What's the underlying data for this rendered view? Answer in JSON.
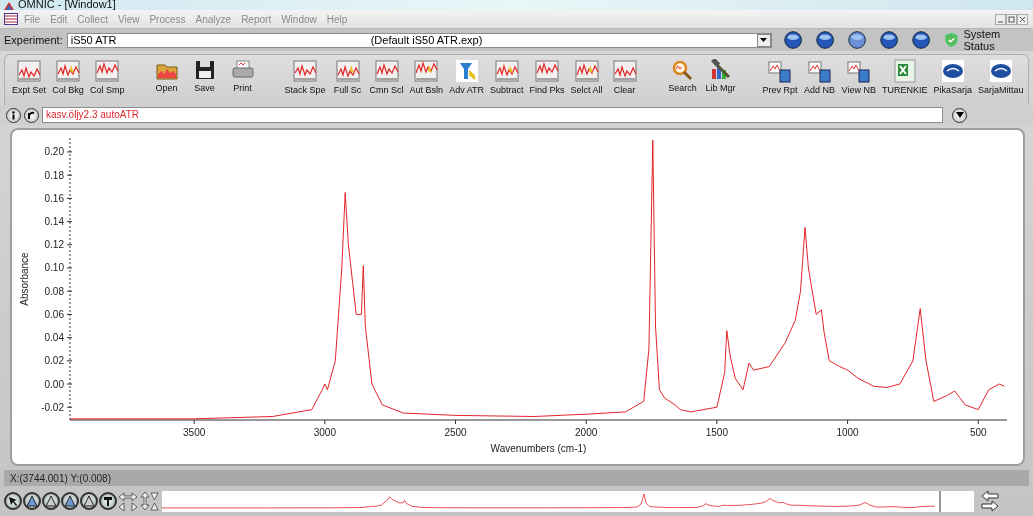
{
  "window": {
    "title": "OMNIC - [Window1]"
  },
  "menu": [
    "File",
    "Edit",
    "Collect",
    "View",
    "Process",
    "Analyze",
    "Report",
    "Window",
    "Help"
  ],
  "experiment": {
    "label": "Experiment:",
    "value": "iS50 ATR",
    "file": "(Default iS50 ATR.exp)",
    "status": "System Status"
  },
  "toolbar": {
    "groups": [
      [
        "Expt Set",
        "Col Bkg",
        "Col Smp"
      ],
      [
        "Open",
        "Save",
        "Print"
      ],
      [
        "Stack Spe",
        "Full Sc",
        "Cmn Scl",
        "Aut Bsln",
        "Adv ATR",
        "Subtract",
        "Find Pks",
        "Selct All",
        "Clear"
      ],
      [
        "Search",
        "Lib Mgr"
      ],
      [
        "Prev Rpt",
        "Add NB",
        "View NB",
        "TURENKIE",
        "PikaSarja",
        "SarjaMittau"
      ]
    ]
  },
  "spectrum_title": "kasv.öljy2.3 autoATR",
  "chart_data": {
    "type": "line",
    "xlabel": "Wavenumbers (cm-1)",
    "ylabel": "Absorbance",
    "x": [
      3975,
      3500,
      3200,
      3050,
      3010,
      3000,
      2990,
      2960,
      2935,
      2922,
      2910,
      2880,
      2860,
      2853,
      2845,
      2820,
      2780,
      2700,
      2500,
      2200,
      2000,
      1850,
      1780,
      1760,
      1745,
      1735,
      1720,
      1700,
      1660,
      1640,
      1600,
      1500,
      1470,
      1462,
      1450,
      1430,
      1400,
      1377,
      1360,
      1300,
      1240,
      1220,
      1200,
      1180,
      1163,
      1150,
      1120,
      1100,
      1090,
      1070,
      1030,
      1000,
      960,
      900,
      850,
      800,
      750,
      722,
      700,
      670,
      620,
      590,
      550,
      500,
      460,
      420,
      400
    ],
    "series": [
      {
        "color": "#e3242b",
        "values": [
          -0.03,
          -0.03,
          -0.028,
          -0.022,
          -0.005,
          0.0,
          -0.005,
          0.02,
          0.1,
          0.165,
          0.12,
          0.06,
          0.06,
          0.102,
          0.05,
          0.0,
          -0.018,
          -0.025,
          -0.027,
          -0.028,
          -0.026,
          -0.024,
          -0.015,
          0.03,
          0.21,
          0.05,
          -0.005,
          -0.012,
          -0.018,
          -0.022,
          -0.024,
          -0.02,
          0.01,
          0.046,
          0.025,
          0.005,
          -0.005,
          0.018,
          0.012,
          0.015,
          0.035,
          0.045,
          0.055,
          0.08,
          0.135,
          0.1,
          0.06,
          0.064,
          0.045,
          0.02,
          0.015,
          0.012,
          0.005,
          -0.002,
          -0.003,
          0.0,
          0.02,
          0.065,
          0.02,
          -0.015,
          -0.01,
          -0.006,
          -0.018,
          -0.022,
          -0.005,
          0.0,
          -0.002
        ]
      }
    ],
    "xlim": [
      3975,
      390
    ],
    "ylim": [
      -0.031,
      0.212
    ],
    "xticks": [
      3500,
      3000,
      2500,
      2000,
      1500,
      1000,
      500
    ],
    "yticks": [
      {
        "value": 0.2,
        "label": "0.20"
      },
      {
        "value": 0.18,
        "label": "0.18"
      },
      {
        "value": 0.16,
        "label": "0.16"
      },
      {
        "value": 0.14,
        "label": "0.14"
      },
      {
        "value": 0.12,
        "label": "0.12"
      },
      {
        "value": 0.1,
        "label": "0.10"
      },
      {
        "value": 0.08,
        "label": "0.08"
      },
      {
        "value": 0.06,
        "label": "0.06"
      },
      {
        "value": 0.04,
        "label": "0.04"
      },
      {
        "value": 0.02,
        "label": "0.02"
      },
      {
        "value": 0,
        "label": "0.00"
      },
      {
        "value": -0.02,
        "label": "-0.02"
      }
    ]
  },
  "status_bar": "X:(3744.001) Y:(0.008)"
}
